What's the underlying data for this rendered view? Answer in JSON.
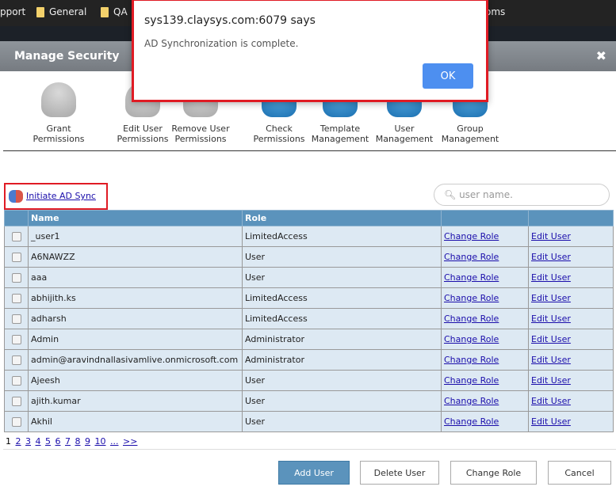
{
  "bookmarks": [
    {
      "label": "pport"
    },
    {
      "label": "General"
    },
    {
      "label": "QA"
    },
    {
      "label": "oms"
    }
  ],
  "header": {
    "title": "Manage Security",
    "close": "✖"
  },
  "toolbar": [
    {
      "label": "Grant Permissions",
      "style": "gray"
    },
    {
      "label": "Edit User Permissions",
      "style": "gray"
    },
    {
      "label": "Remove User Permissions",
      "style": "gray"
    },
    {
      "label": "Check Permissions",
      "style": "blue"
    },
    {
      "label": "Template Management",
      "style": "blue"
    },
    {
      "label": "User Management",
      "style": "blue"
    },
    {
      "label": "Group Management",
      "style": "blue"
    }
  ],
  "sync_link": "Initiate AD Sync",
  "search": {
    "placeholder": "user name."
  },
  "table": {
    "headers": [
      "",
      "Name",
      "Role",
      "",
      ""
    ],
    "rows": [
      {
        "name": "_user1",
        "role": "LimitedAccess"
      },
      {
        "name": "A6NAWZZ",
        "role": "User"
      },
      {
        "name": "aaa",
        "role": "User"
      },
      {
        "name": "abhijith.ks",
        "role": "LimitedAccess"
      },
      {
        "name": "adharsh",
        "role": "LimitedAccess"
      },
      {
        "name": "Admin",
        "role": "Administrator"
      },
      {
        "name": "admin@aravindnallasivamlive.onmicrosoft.com",
        "role": "Administrator"
      },
      {
        "name": "Ajeesh",
        "role": "User"
      },
      {
        "name": "ajith.kumar",
        "role": "User"
      },
      {
        "name": "Akhil",
        "role": "User"
      }
    ],
    "change_role": "Change Role",
    "edit_user": "Edit User"
  },
  "pager": {
    "current": "1",
    "pages": [
      "2",
      "3",
      "4",
      "5",
      "6",
      "7",
      "8",
      "9",
      "10",
      "...",
      ">>"
    ]
  },
  "buttons": {
    "add": "Add User",
    "delete": "Delete User",
    "change_role": "Change Role",
    "cancel": "Cancel"
  },
  "dialog": {
    "title": "sys139.claysys.com:6079 says",
    "message": "AD Synchronization is complete.",
    "ok": "OK"
  }
}
